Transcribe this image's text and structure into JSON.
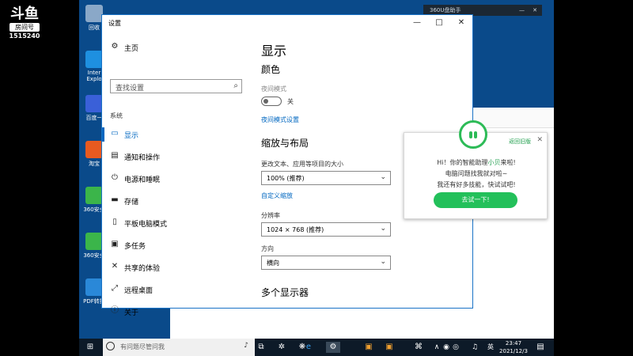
{
  "overlay": {
    "brand": "斗鱼",
    "brand_sub": "房间号",
    "room_number": "1515240"
  },
  "desktop": {
    "icons": [
      {
        "label": "回收",
        "icon": "recycle-bin-icon",
        "color": "#8aa8c8"
      },
      {
        "label": "Inter Explo",
        "icon": "ie-icon",
        "color": "#1e90e0"
      },
      {
        "label": "百度一",
        "icon": "baidu-icon",
        "color": "#3a60d8"
      },
      {
        "label": "淘宝",
        "icon": "taobao-icon",
        "color": "#e85a20"
      },
      {
        "label": "360安全",
        "icon": "360-security-icon",
        "color": "#3bb54a"
      },
      {
        "label": "360安全",
        "icon": "360-guard-icon",
        "color": "#3bb54a"
      },
      {
        "label": "PDF转换",
        "icon": "pdf-converter-icon",
        "color": "#2a88d8"
      }
    ]
  },
  "top_window_title": "360U盘助手",
  "settings": {
    "title": "设置",
    "nav": {
      "home": "主页",
      "search_placeholder": "查找设置",
      "section": "系统",
      "items": [
        {
          "label": "显示",
          "icon": "monitor-icon",
          "glyph": "▭",
          "active": true
        },
        {
          "label": "通知和操作",
          "icon": "notification-icon",
          "glyph": "▤",
          "active": false
        },
        {
          "label": "电源和睡眠",
          "icon": "power-icon",
          "glyph": "⏻",
          "active": false
        },
        {
          "label": "存储",
          "icon": "storage-icon",
          "glyph": "▬",
          "active": false
        },
        {
          "label": "平板电脑模式",
          "icon": "tablet-icon",
          "glyph": "▯",
          "active": false
        },
        {
          "label": "多任务",
          "icon": "multitask-icon",
          "glyph": "▣",
          "active": false
        },
        {
          "label": "共享的体验",
          "icon": "shared-experience-icon",
          "glyph": "✕",
          "active": false
        },
        {
          "label": "远程桌面",
          "icon": "remote-desktop-icon",
          "glyph": "⤢",
          "active": false
        },
        {
          "label": "关于",
          "icon": "info-icon",
          "glyph": "ⓘ",
          "active": false
        }
      ]
    },
    "content": {
      "page_title": "显示",
      "color_heading": "颜色",
      "night_mode_label": "夜间模式",
      "night_mode_state": "关",
      "night_mode_on": false,
      "night_mode_link": "夜间模式设置",
      "scale_heading": "缩放与布局",
      "scale_label": "更改文本、应用等项目的大小",
      "scale_value": "100% (推荐)",
      "custom_scale_link": "自定义缩放",
      "resolution_label": "分辨率",
      "resolution_value": "1024 × 768 (推荐)",
      "orientation_label": "方向",
      "orientation_value": "横向",
      "multi_display_heading": "多个显示器"
    }
  },
  "popup": {
    "feedback_link": "返回旧版",
    "line1_prefix": "Hi！你的智能助理",
    "assistant_name": "小贝",
    "line1_suffix": "来啦!",
    "line2": "电脑问题找我就对啦~",
    "line3": "我还有好多技能，快试试吧!",
    "try_button": "去试一下!",
    "accent": "#23c05a"
  },
  "taskbar": {
    "search_placeholder": "有问题尽管问我",
    "ime": "英",
    "time": "23:47",
    "date": "2021/12/3"
  }
}
